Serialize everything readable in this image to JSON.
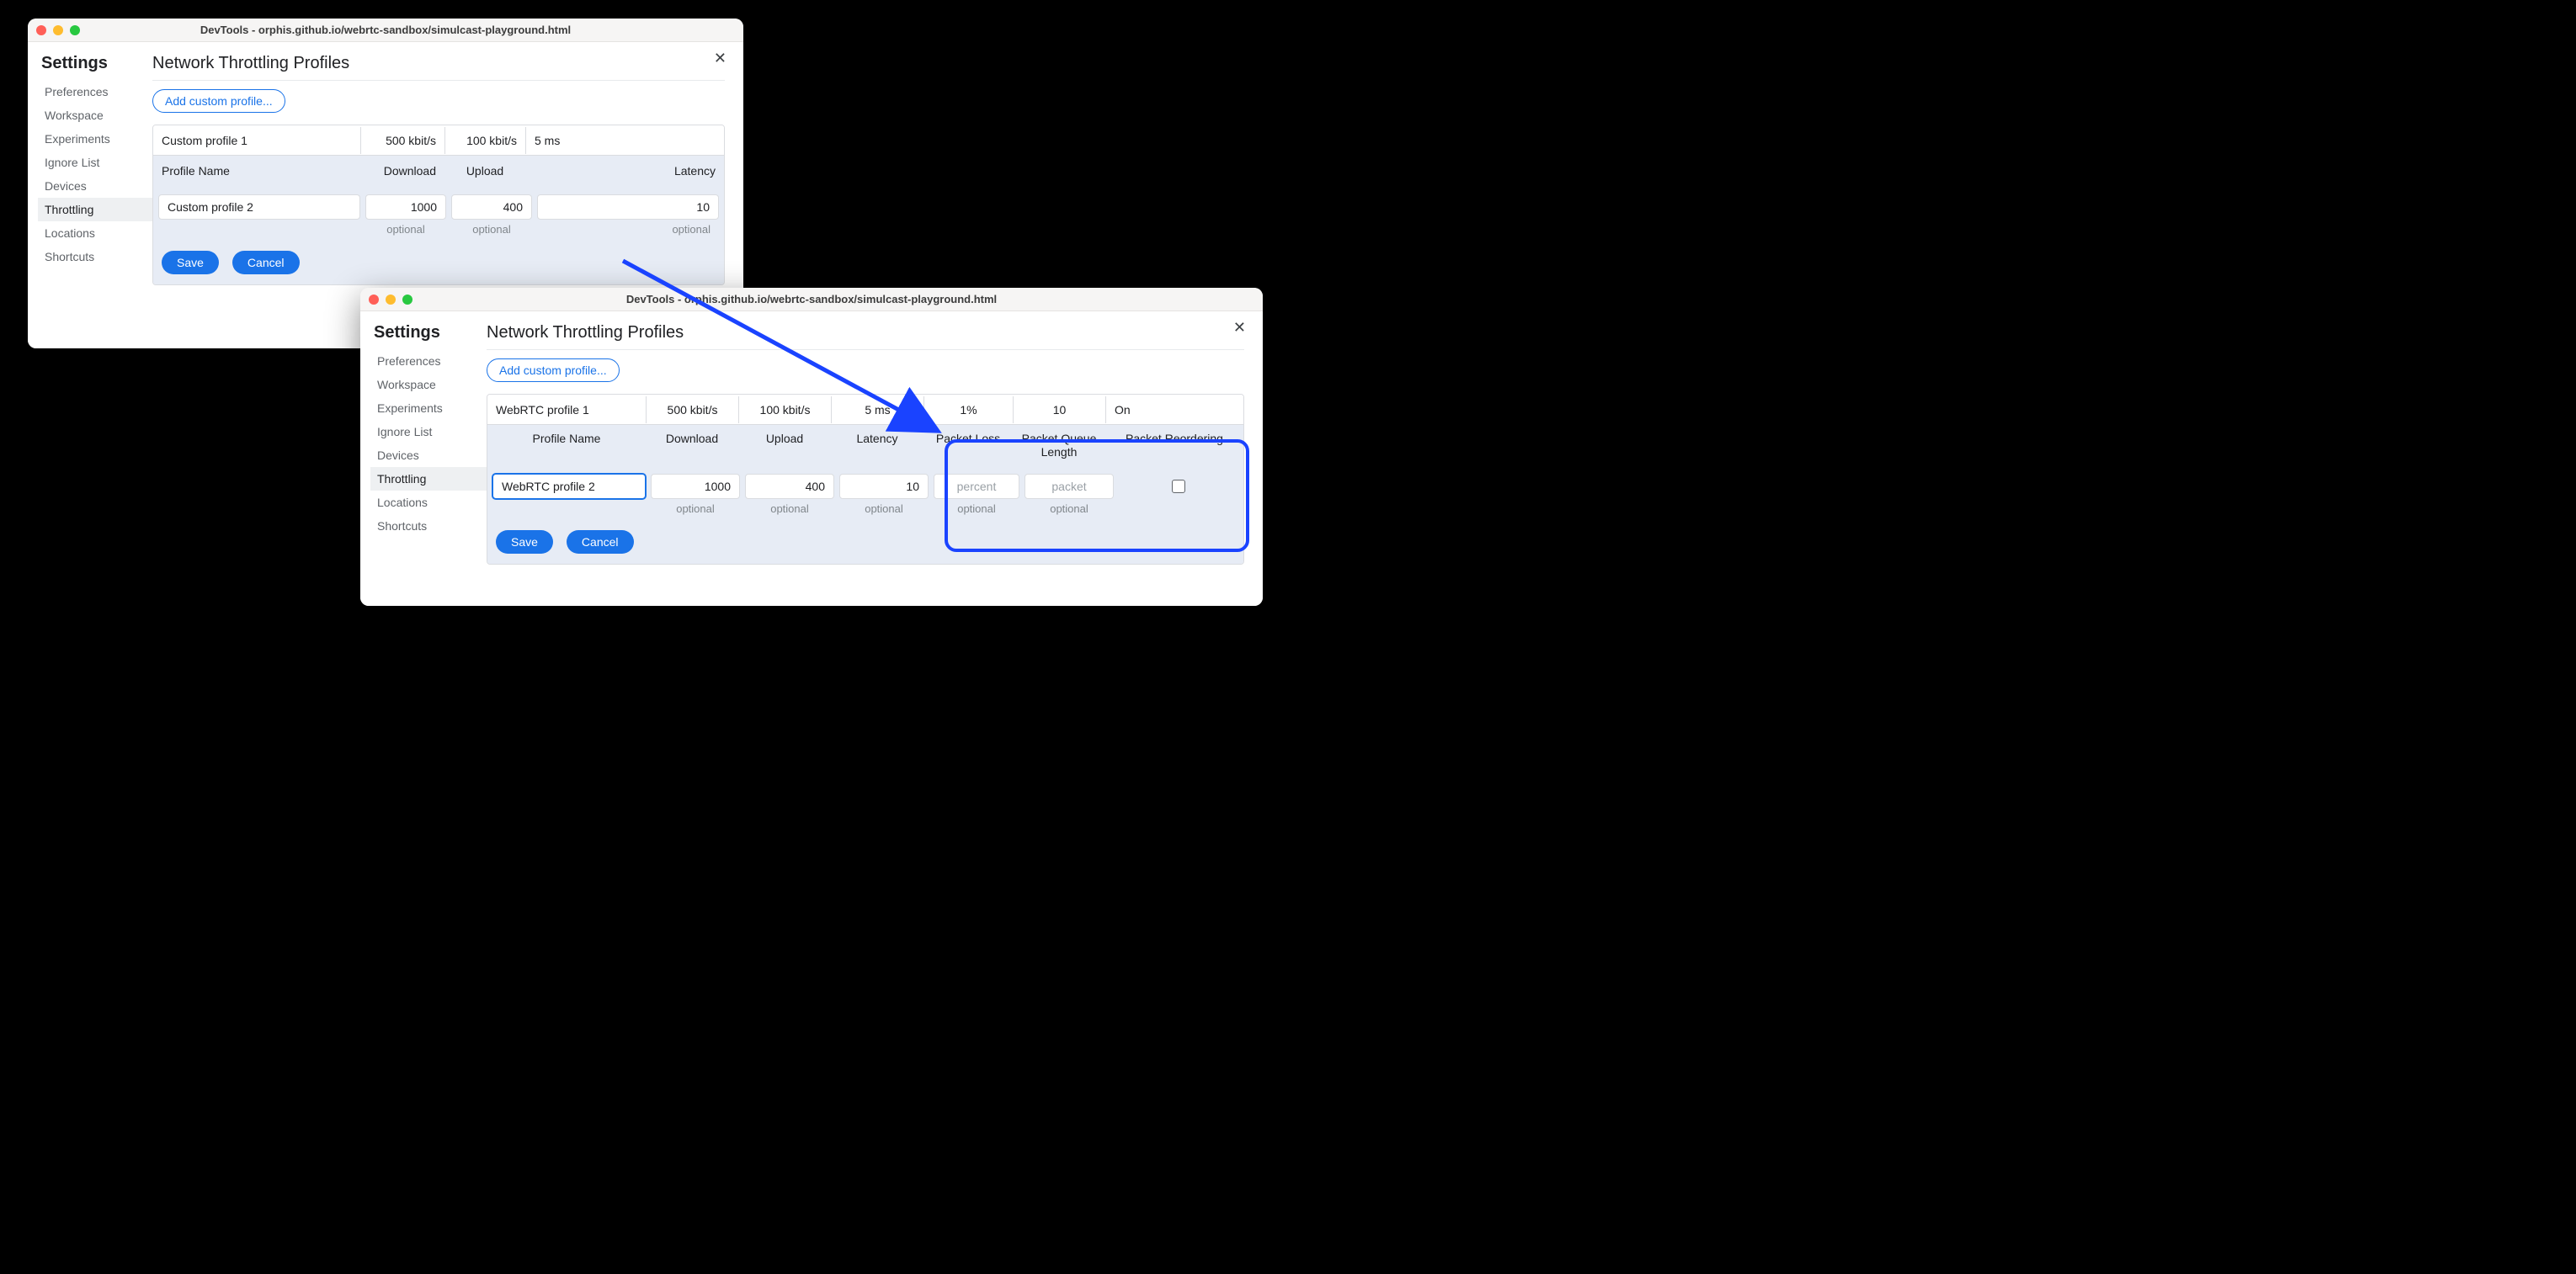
{
  "windowA": {
    "title": "DevTools - orphis.github.io/webrtc-sandbox/simulcast-playground.html",
    "settings_heading": "Settings",
    "nav": [
      "Preferences",
      "Workspace",
      "Experiments",
      "Ignore List",
      "Devices",
      "Throttling",
      "Locations",
      "Shortcuts"
    ],
    "active_nav_index": 5,
    "page_heading": "Network Throttling Profiles",
    "add_button": "Add custom profile...",
    "existing": {
      "name": "Custom profile 1",
      "download": "500 kbit/s",
      "upload": "100 kbit/s",
      "latency": "5 ms"
    },
    "headers": [
      "Profile Name",
      "Download",
      "Upload",
      "Latency"
    ],
    "edit": {
      "name": "Custom profile 2",
      "download": "1000",
      "upload": "400",
      "latency": "10"
    },
    "hints": [
      "optional",
      "optional",
      "optional"
    ],
    "save": "Save",
    "cancel": "Cancel"
  },
  "windowB": {
    "title": "DevTools - orphis.github.io/webrtc-sandbox/simulcast-playground.html",
    "settings_heading": "Settings",
    "nav": [
      "Preferences",
      "Workspace",
      "Experiments",
      "Ignore List",
      "Devices",
      "Throttling",
      "Locations",
      "Shortcuts"
    ],
    "active_nav_index": 5,
    "page_heading": "Network Throttling Profiles",
    "add_button": "Add custom profile...",
    "existing": {
      "name": "WebRTC profile 1",
      "download": "500 kbit/s",
      "upload": "100 kbit/s",
      "latency": "5 ms",
      "packet_loss": "1%",
      "packet_queue": "10",
      "reordering": "On"
    },
    "headers": [
      "Profile Name",
      "Download",
      "Upload",
      "Latency",
      "Packet Loss",
      "Packet Queue Length",
      "Packet Reordering"
    ],
    "edit": {
      "name": "WebRTC profile 2",
      "download": "1000",
      "upload": "400",
      "latency": "10",
      "packet_loss_placeholder": "percent",
      "packet_queue_placeholder": "packet"
    },
    "hints": [
      "optional",
      "optional",
      "optional",
      "optional",
      "optional"
    ],
    "save": "Save",
    "cancel": "Cancel"
  }
}
